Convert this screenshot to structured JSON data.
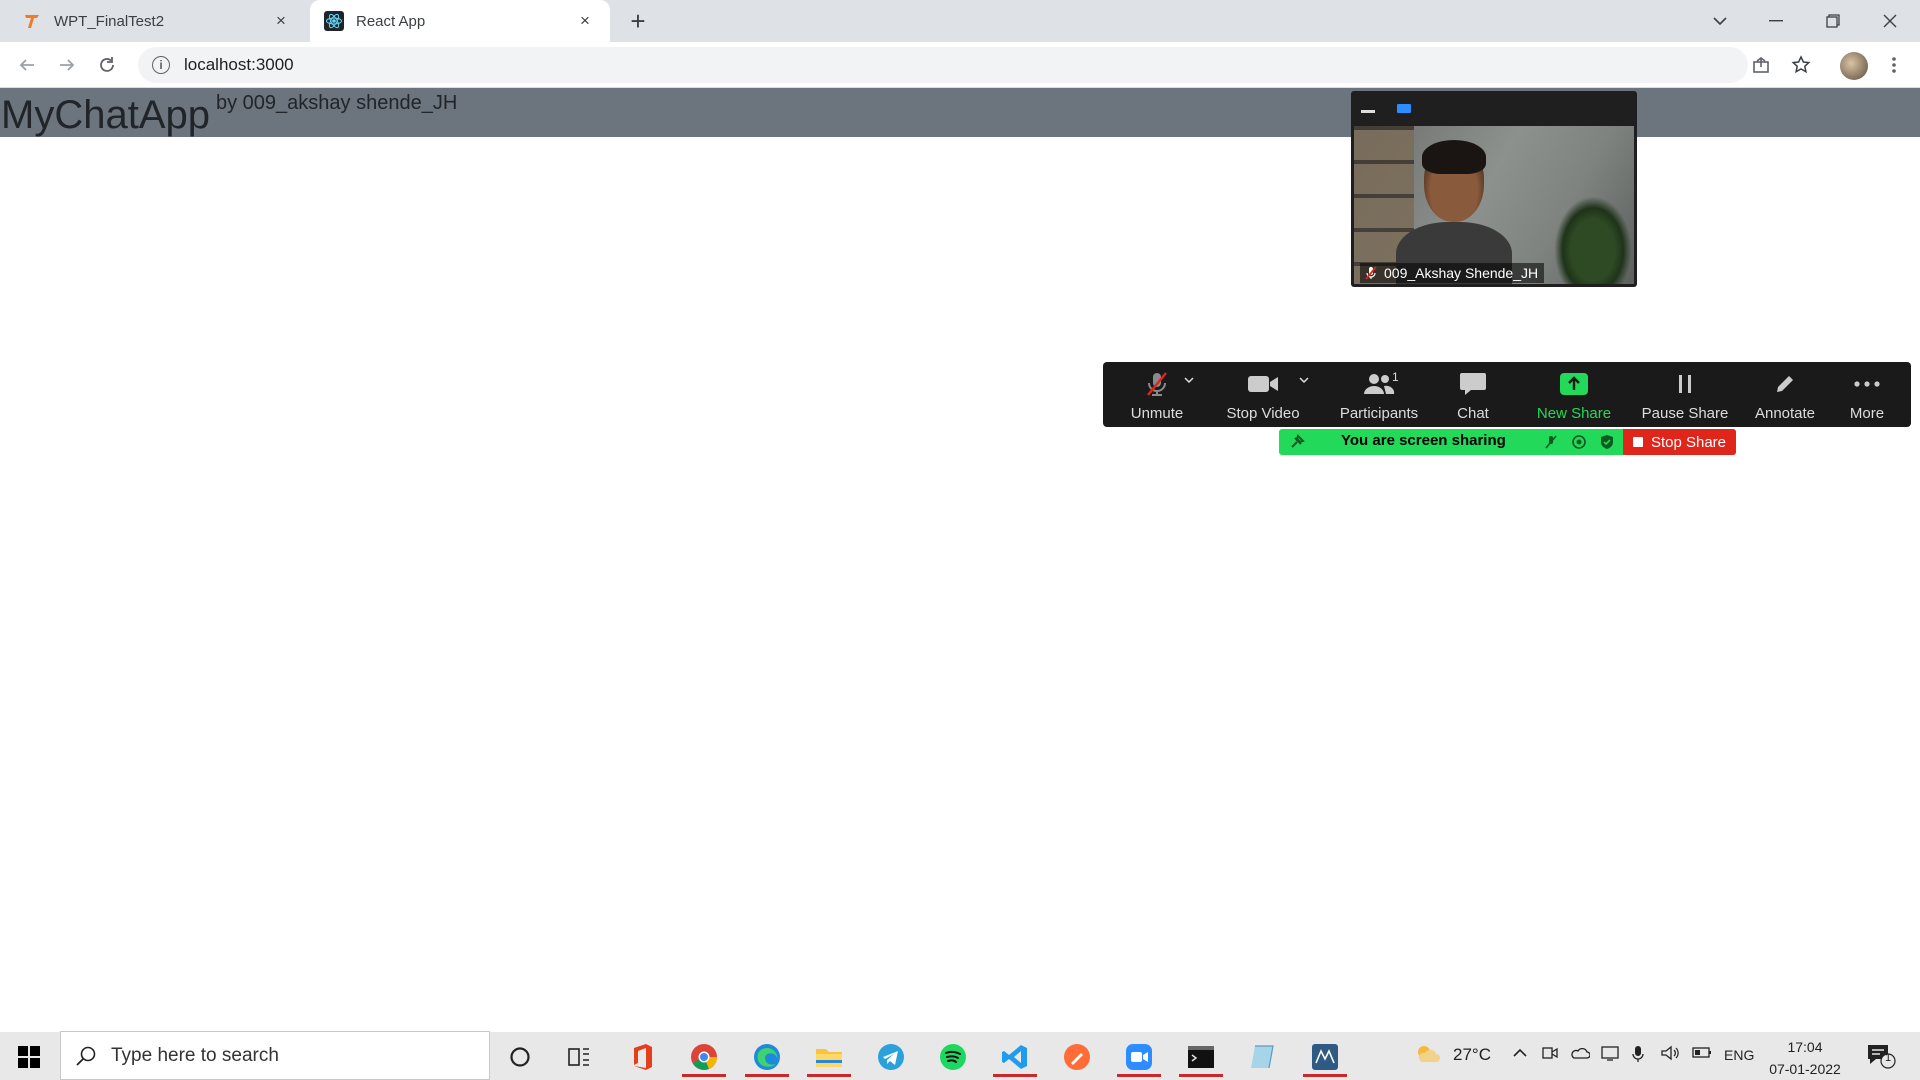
{
  "browser": {
    "tabs": [
      {
        "title": "WPT_FinalTest2",
        "active": false,
        "favicon": "t-logo-icon"
      },
      {
        "title": "React App",
        "active": true,
        "favicon": "react-icon"
      }
    ],
    "close_symbol": "×",
    "new_tab_symbol": "+",
    "url": "localhost:3000"
  },
  "page": {
    "app_title": "MyChatApp",
    "byline": "by 009_akshay shende_JH",
    "navbar_color": "#6c757d"
  },
  "zoom": {
    "video_participant": "009_Akshay Shende_JH",
    "toolbar": {
      "unmute": "Unmute",
      "stop_video": "Stop Video",
      "participants": "Participants",
      "participants_count": "1",
      "chat": "Chat",
      "new_share": "New Share",
      "pause_share": "Pause Share",
      "annotate": "Annotate",
      "more": "More"
    },
    "sharing_status": "You are screen sharing",
    "stop_share": "Stop Share",
    "accent_green": "#23d959",
    "stop_red": "#e0251b"
  },
  "taskbar": {
    "search_placeholder": "Type here to search",
    "weather": "27°C",
    "language": "ENG",
    "time": "17:04",
    "date": "07-01-2022",
    "notification_count": "1"
  }
}
